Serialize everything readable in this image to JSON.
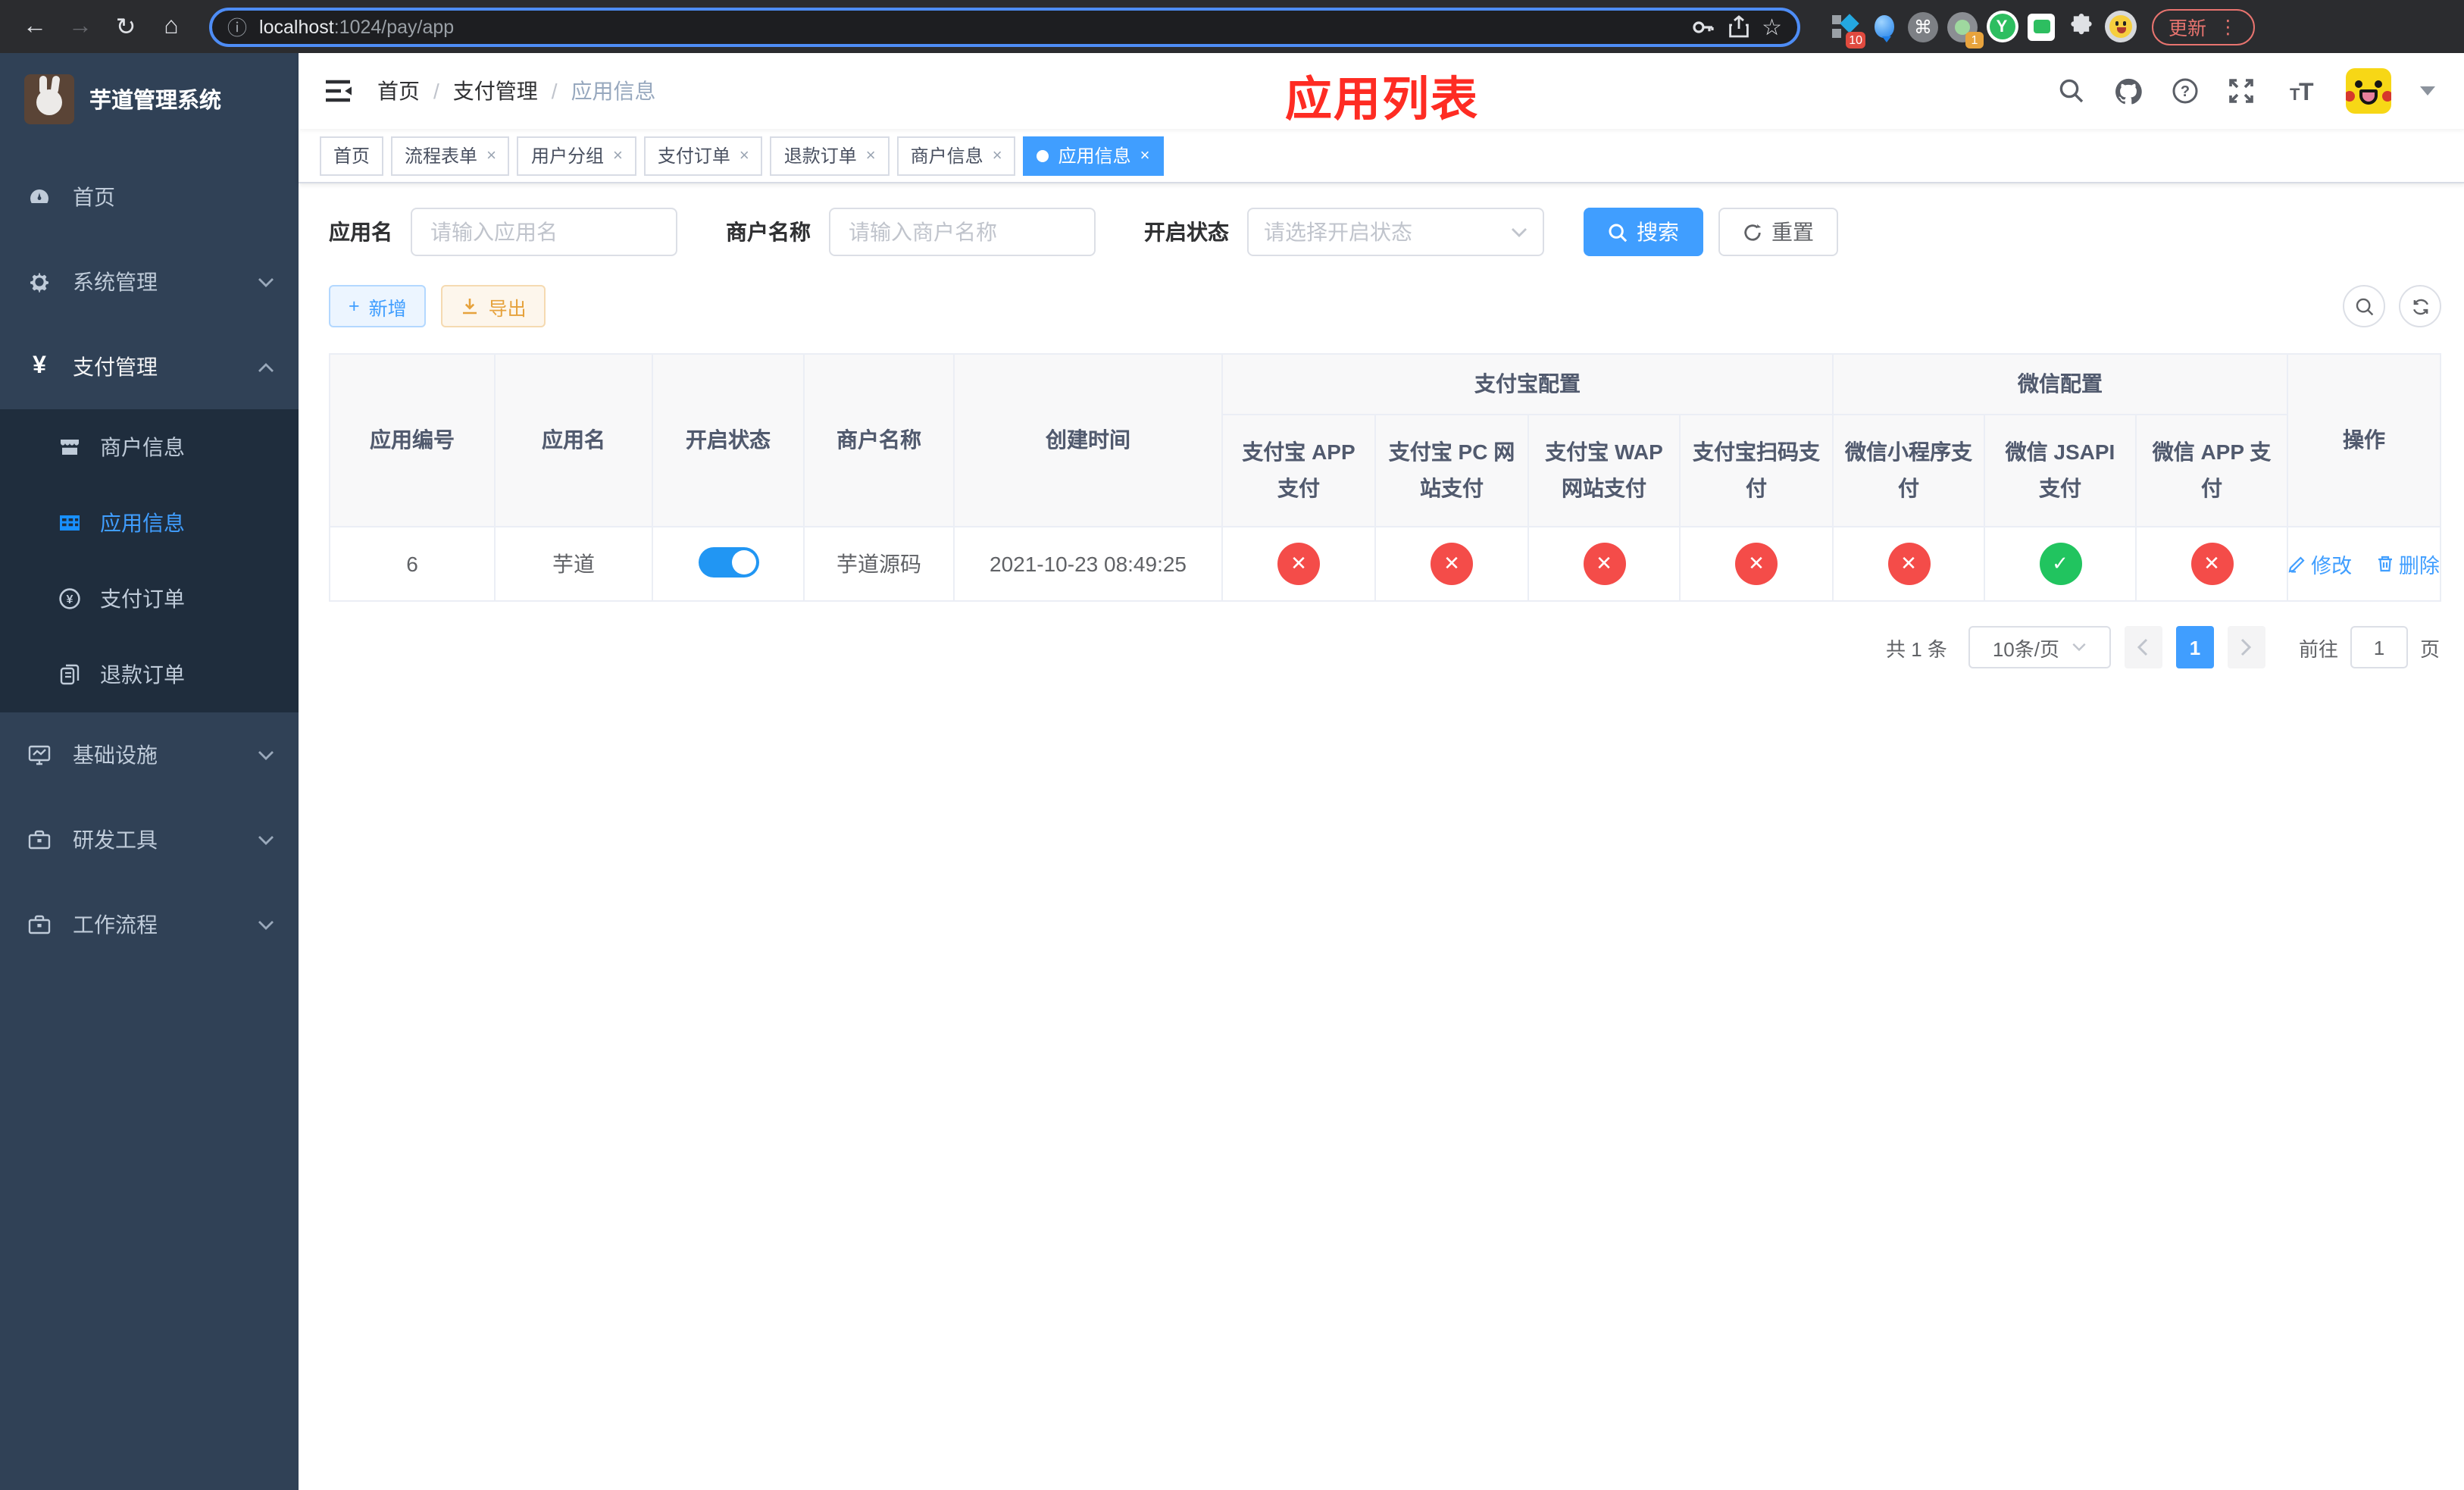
{
  "colors": {
    "accent": "#409eff",
    "danger": "#f44c49",
    "success": "#21c45f",
    "sidebar_bg": "#304156",
    "submenu_bg": "#1f2d3d",
    "annotation_red": "#fe2c23",
    "tag_active": "#409eff"
  },
  "browser": {
    "url_host": "localhost",
    "url_rest": ":1024/pay/app",
    "update_label": "更新",
    "menu_dots": "⋮",
    "ext_badge_pieces": "10",
    "ext_badge_record": "1",
    "ext_y_letter": "Y",
    "ext_command_glyph": "⌘"
  },
  "icons": {
    "back": "←",
    "forward": "→",
    "reload": "↻",
    "home": "⌂",
    "info": "ⓘ",
    "star": "☆",
    "close": "×",
    "check": "✓",
    "cross": "✕",
    "plus": "+",
    "search": "🔍"
  },
  "sidebar": {
    "title": "芋道管理系统",
    "items": [
      {
        "label": "首页"
      },
      {
        "label": "系统管理"
      },
      {
        "label": "支付管理"
      },
      {
        "label": "商户信息"
      },
      {
        "label": "应用信息"
      },
      {
        "label": "支付订单"
      },
      {
        "label": "退款订单"
      },
      {
        "label": "基础设施"
      },
      {
        "label": "研发工具"
      },
      {
        "label": "工作流程"
      }
    ]
  },
  "header": {
    "breadcrumb": [
      "首页",
      "支付管理",
      "应用信息"
    ],
    "separator": "/",
    "annotation": "应用列表"
  },
  "tabs": {
    "close_glyph": "×",
    "items": [
      {
        "label": "首页"
      },
      {
        "label": "流程表单"
      },
      {
        "label": "用户分组"
      },
      {
        "label": "支付订单"
      },
      {
        "label": "退款订单"
      },
      {
        "label": "商户信息"
      },
      {
        "label": "应用信息"
      }
    ]
  },
  "filters": {
    "app_name_label": "应用名",
    "app_name_placeholder": "请输入应用名",
    "merchant_label": "商户名称",
    "merchant_placeholder": "请输入商户名称",
    "status_label": "开启状态",
    "status_placeholder": "请选择开启状态",
    "search_label": "搜索",
    "reset_label": "重置"
  },
  "toolbar": {
    "add_label": "新增",
    "add_icon_glyph": "+",
    "export_label": "导出"
  },
  "table": {
    "headers": {
      "app_id": "应用编号",
      "app_name": "应用名",
      "status": "开启状态",
      "merchant": "商户名称",
      "created": "创建时间",
      "alipay_group": "支付宝配置",
      "wechat_group": "微信配置",
      "actions": "操作",
      "sub": [
        "支付宝 APP 支付",
        "支付宝 PC 网站支付",
        "支付宝 WAP 网站支付",
        "支付宝扫码支付",
        "微信小程序支付",
        "微信 JSAPI 支付",
        "微信 APP 支付"
      ]
    },
    "row": {
      "app_id": "6",
      "app_name": "芋道",
      "switch_cls": "on",
      "merchant": "芋道源码",
      "created": "2021-10-23 08:49:25",
      "statuses": [
        {
          "cls": "red",
          "glyph": "✕"
        },
        {
          "cls": "red",
          "glyph": "✕"
        },
        {
          "cls": "red",
          "glyph": "✕"
        },
        {
          "cls": "red",
          "glyph": "✕"
        },
        {
          "cls": "red",
          "glyph": "✕"
        },
        {
          "cls": "green",
          "glyph": "✓"
        },
        {
          "cls": "red",
          "glyph": "✕"
        }
      ],
      "edit_label": "修改",
      "delete_label": "删除"
    }
  },
  "pagination": {
    "total": "共 1 条",
    "page_size": "10条/页",
    "current_page": "1",
    "goto_label": "前往",
    "goto_value": "1",
    "page_unit": "页"
  }
}
